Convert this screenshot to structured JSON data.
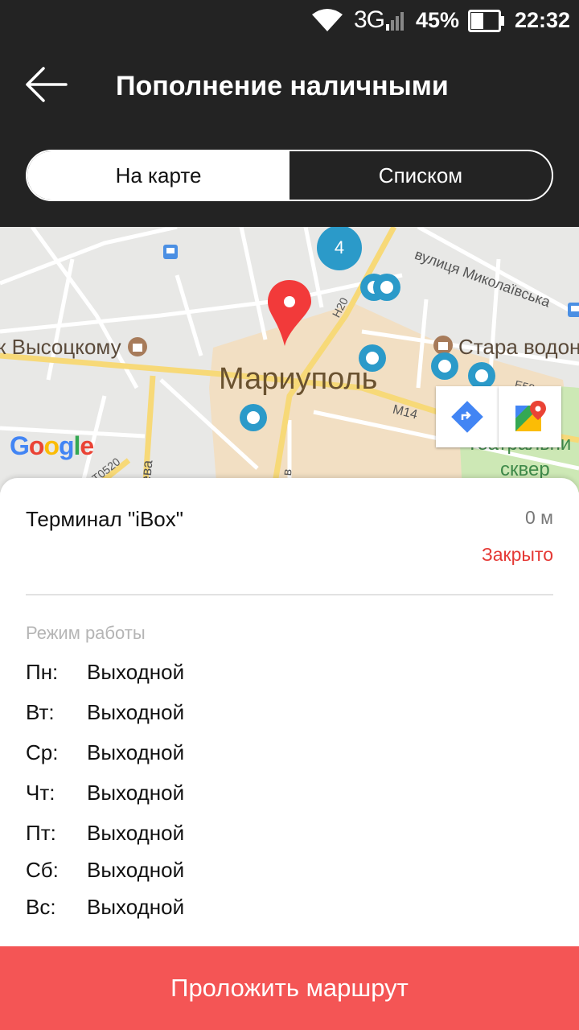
{
  "status_bar": {
    "network": "3G",
    "battery": "45%",
    "time": "22:32",
    "battery_level": 0.45
  },
  "header": {
    "title": "Пополнение наличными"
  },
  "tabs": [
    {
      "label": "На карте",
      "active": true
    },
    {
      "label": "Списком",
      "active": false
    }
  ],
  "map": {
    "city_label": "Мариуполь",
    "label_vysotsky": "к Высоцкому",
    "label_stara": "Стара водона",
    "label_street": "вулиця Миколаївська",
    "label_park_1": "Театральни",
    "label_park_2": "сквер",
    "road_h20": "H20",
    "road_m14": "M14",
    "road_e58": "E58",
    "road_t0520": "T0520",
    "label_eva": "ева",
    "label_v": "в",
    "cluster_count": "4",
    "google_logo": "Google",
    "pin_color": "#f23a3a",
    "marker_color": "#2b9ac9"
  },
  "terminal": {
    "name": "Терминал \"iBox\"",
    "distance": "0 м",
    "status": "Закрыто"
  },
  "hours": {
    "title": "Режим работы",
    "days": [
      {
        "day": "Пн:",
        "value": "Выходной"
      },
      {
        "day": "Вт:",
        "value": "Выходной"
      },
      {
        "day": "Ср:",
        "value": "Выходной"
      },
      {
        "day": "Чт:",
        "value": "Выходной"
      },
      {
        "day": "Пт:",
        "value": "Выходной"
      },
      {
        "day": "Сб:",
        "value": "Выходной"
      },
      {
        "day": "Вс:",
        "value": "Выходной"
      }
    ]
  },
  "route_button": {
    "label": "Проложить маршрут"
  },
  "icons": [
    "wifi-icon",
    "signal-icon",
    "battery-icon",
    "back-arrow-icon",
    "directions-icon",
    "google-maps-icon",
    "location-pin-icon",
    "museum-icon",
    "bus-stop-icon"
  ]
}
